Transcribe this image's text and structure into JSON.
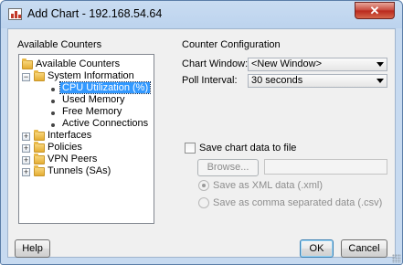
{
  "window": {
    "title": "Add Chart - 192.168.54.64",
    "close_label": "✕"
  },
  "counters": {
    "heading": "Available Counters",
    "root": "Available Counters",
    "system_information": "System Information",
    "system_items": [
      "CPU Utilization (%)",
      "Used Memory",
      "Free Memory",
      "Active Connections"
    ],
    "selected_item": "CPU Utilization (%)",
    "groups": [
      "Interfaces",
      "Policies",
      "VPN Peers",
      "Tunnels (SAs)"
    ],
    "expand_symbol": "+",
    "collapse_symbol": "−"
  },
  "config": {
    "heading": "Counter Configuration",
    "chart_window_label": "Chart Window:",
    "chart_window_value": "<New Window>",
    "poll_interval_label": "Poll Interval:",
    "poll_interval_value": "30 seconds",
    "save_checkbox_label": "Save chart data to file",
    "save_checked": false,
    "browse_label": "Browse...",
    "file_path_value": "",
    "xml_option_label": "Save as XML data (.xml)",
    "csv_option_label": "Save as comma separated data (.csv)",
    "selected_format": "xml"
  },
  "footer": {
    "help_label": "Help",
    "ok_label": "OK",
    "cancel_label": "Cancel"
  }
}
